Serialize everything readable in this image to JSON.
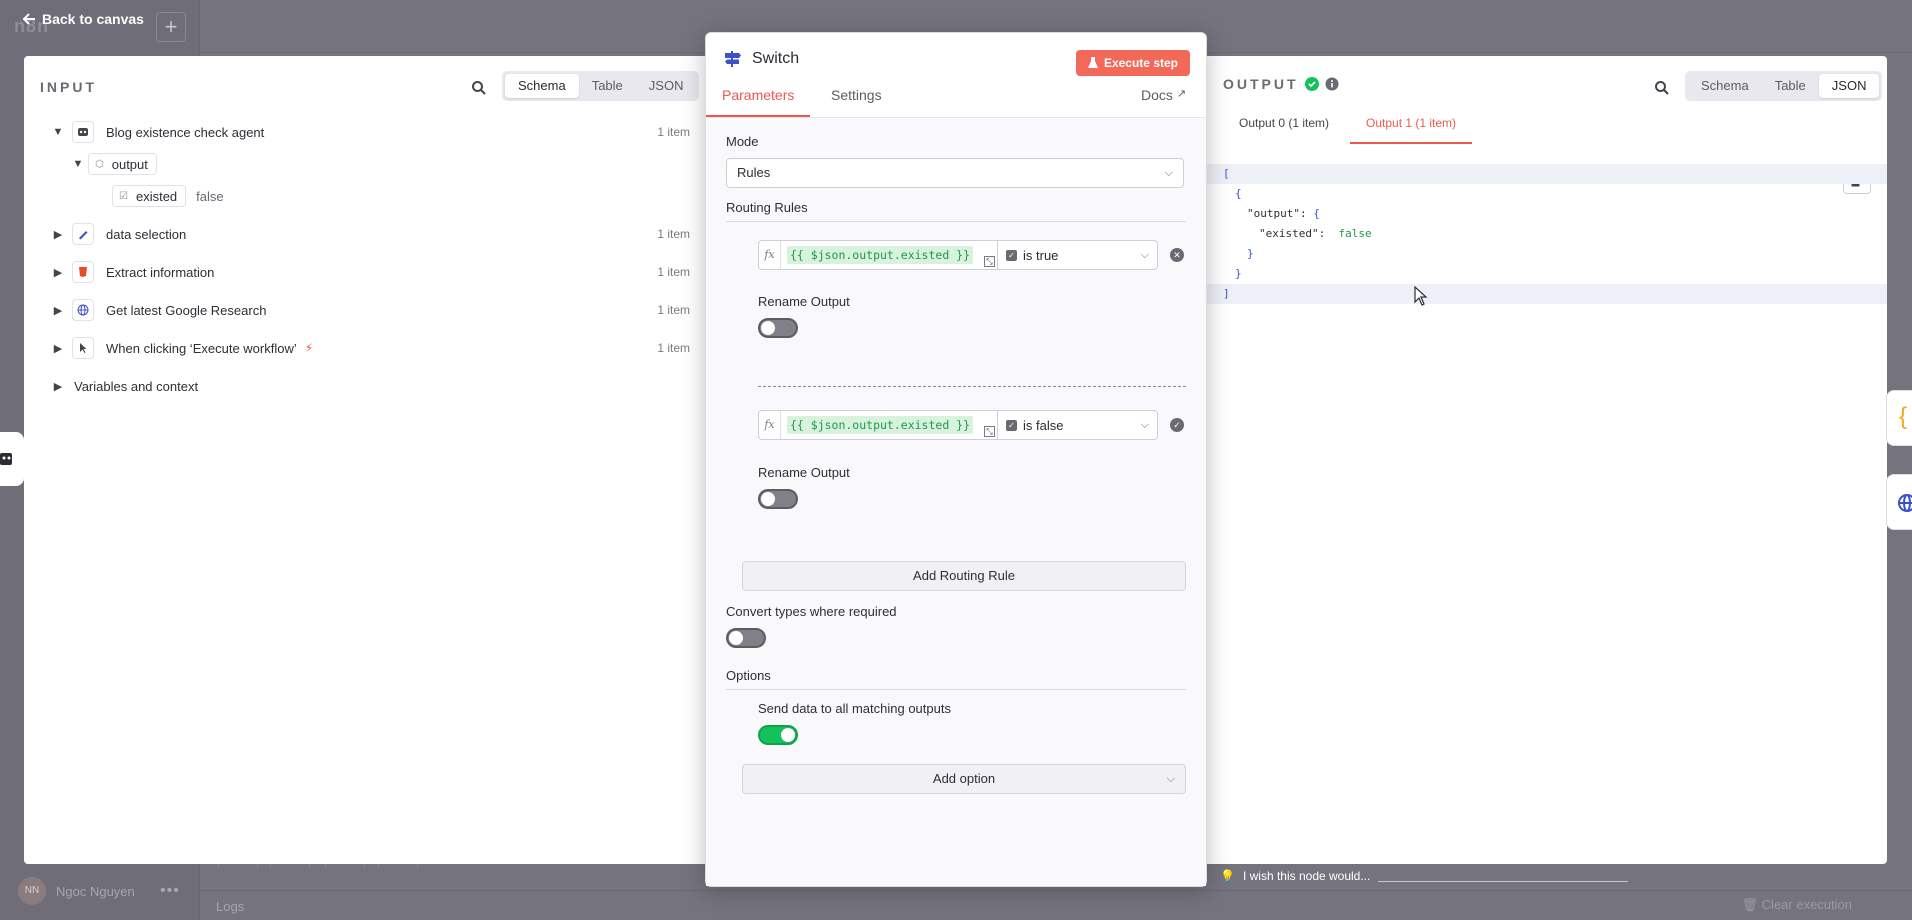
{
  "background": {
    "logo_text": "n8n",
    "user": {
      "initials": "NN",
      "name": "Ngoc Nguyen"
    },
    "logs_label": "Logs",
    "clear_label": "Clear execution"
  },
  "back_to_canvas": "Back to canvas",
  "input": {
    "title": "INPUT",
    "views": [
      "Schema",
      "Table",
      "JSON"
    ],
    "active_view": "Schema",
    "nodes": [
      {
        "label": "Blog existence check agent",
        "count": "1 item",
        "icon": "robot-icon",
        "expanded": true
      },
      {
        "label": "data selection",
        "count": "1 item",
        "icon": "pencil-icon"
      },
      {
        "label": "Extract information",
        "count": "1 item",
        "icon": "html5-icon"
      },
      {
        "label": "Get latest Google Research",
        "count": "1 item",
        "icon": "globe-icon"
      },
      {
        "label": "When clicking ‘Execute workflow’",
        "count": "1 item",
        "icon": "pointer-icon"
      }
    ],
    "output_field": "output",
    "existed_field": "existed",
    "existed_value": "false",
    "variables_label": "Variables and context"
  },
  "node": {
    "title": "Switch",
    "execute_label": "Execute step",
    "tabs": {
      "parameters": "Parameters",
      "settings": "Settings",
      "docs": "Docs"
    },
    "mode_label": "Mode",
    "mode_value": "Rules",
    "routing_rules_label": "Routing Rules",
    "rules": [
      {
        "expression": "{{ $json.output.existed }}",
        "condition": "is true",
        "rename_label": "Rename Output",
        "rename_on": false
      },
      {
        "expression": "{{ $json.output.existed }}",
        "condition": "is false",
        "rename_label": "Rename Output",
        "rename_on": false
      }
    ],
    "add_rule_label": "Add Routing Rule",
    "convert_label": "Convert types where required",
    "options_label": "Options",
    "send_all_label": "Send data to all matching outputs",
    "send_all_on": true,
    "add_option_label": "Add option"
  },
  "output": {
    "title": "OUTPUT",
    "views": [
      "Schema",
      "Table",
      "JSON"
    ],
    "active_view": "JSON",
    "tabs": [
      "Output 0 (1 item)",
      "Output 1 (1 item)"
    ],
    "active_tab": 1,
    "json": {
      "key_output": "\"output\"",
      "key_existed": "\"existed\"",
      "value_existed": "false"
    }
  },
  "feedback_placeholder": "I wish this node would...",
  "colors": {
    "accent": "#ea5a4a",
    "execute": "#f2695a",
    "toggle_on": "#13c25a",
    "json_value": "#1c9a4a",
    "json_bracket": "#3b50c9"
  }
}
